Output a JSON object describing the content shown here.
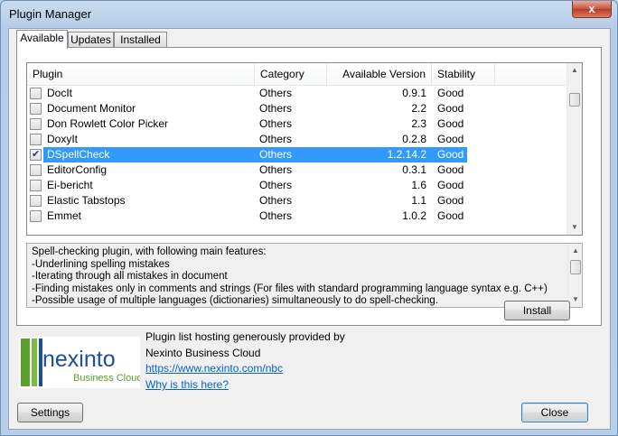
{
  "window": {
    "title": "Plugin Manager",
    "close_glyph": "x"
  },
  "tabs": [
    {
      "label": "Available",
      "active": true
    },
    {
      "label": "Updates",
      "active": false
    },
    {
      "label": "Installed",
      "active": false
    }
  ],
  "list": {
    "columns": [
      "Plugin",
      "Category",
      "Available Version",
      "Stability"
    ],
    "rows": [
      {
        "name": "DocIt",
        "category": "Others",
        "version": "0.9.1",
        "stability": "Good",
        "checked": false,
        "selected": false
      },
      {
        "name": "Document Monitor",
        "category": "Others",
        "version": "2.2",
        "stability": "Good",
        "checked": false,
        "selected": false
      },
      {
        "name": "Don Rowlett Color Picker",
        "category": "Others",
        "version": "2.3",
        "stability": "Good",
        "checked": false,
        "selected": false
      },
      {
        "name": "DoxyIt",
        "category": "Others",
        "version": "0.2.8",
        "stability": "Good",
        "checked": false,
        "selected": false
      },
      {
        "name": "DSpellCheck",
        "category": "Others",
        "version": "1.2.14.2",
        "stability": "Good",
        "checked": true,
        "selected": true
      },
      {
        "name": "EditorConfig",
        "category": "Others",
        "version": "0.3.1",
        "stability": "Good",
        "checked": false,
        "selected": false
      },
      {
        "name": "Ei-bericht",
        "category": "Others",
        "version": "1.6",
        "stability": "Good",
        "checked": false,
        "selected": false
      },
      {
        "name": "Elastic Tabstops",
        "category": "Others",
        "version": "1.1",
        "stability": "Good",
        "checked": false,
        "selected": false
      },
      {
        "name": "Emmet",
        "category": "Others",
        "version": "1.0.2",
        "stability": "Good",
        "checked": false,
        "selected": false
      }
    ]
  },
  "description": {
    "lines": [
      "Spell-checking plugin, with following main features:",
      "-Underlining spelling mistakes",
      "-Iterating through all mistakes in document",
      "-Finding mistakes only in comments and strings (For files with standard programming language syntax e.g. C++)",
      "-Possible usage of multiple languages (dictionaries) simultaneously to do spell-checking."
    ]
  },
  "buttons": {
    "install": "Install",
    "settings": "Settings",
    "close": "Close"
  },
  "hosting": {
    "line1": "Plugin list hosting generously provided by",
    "line2": "Nexinto Business Cloud",
    "url": "https://www.nexinto.com/nbc",
    "why": "Why is this here?"
  },
  "logo": {
    "name": "nexinto",
    "tagline": "Business Cloud"
  },
  "colors": {
    "selection": "#3399ff",
    "link": "#0066cc",
    "logo_blue": "#1a4f9c",
    "logo_green": "#5aa02c"
  },
  "icons": {
    "scroll_up": "scroll-up-arrow-icon",
    "scroll_down": "scroll-down-arrow-icon",
    "check": "checkmark-icon"
  }
}
